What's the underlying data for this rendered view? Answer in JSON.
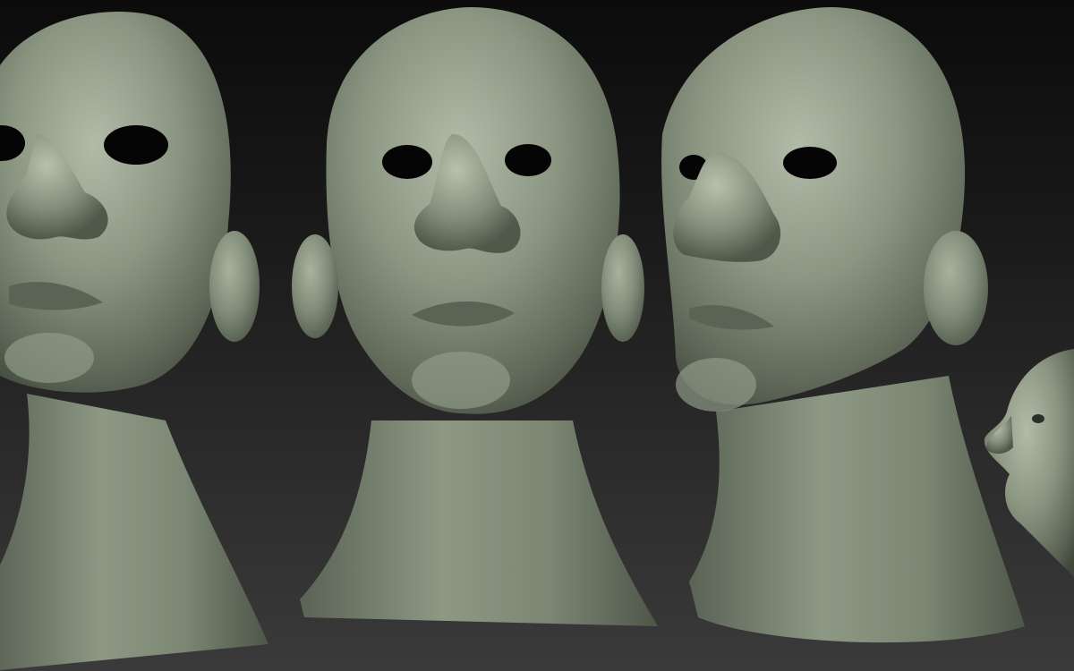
{
  "scene": {
    "description_tokens": [],
    "colors": {
      "background_top": "#0b0b0b",
      "background_bottom": "#3a3a3a",
      "clay_base": "#7f8b78",
      "clay_light": "#aab3a1",
      "clay_dark": "#4b5346",
      "cavity": "#050505"
    },
    "models": [
      {
        "name": "head-front-cropped-left"
      },
      {
        "name": "head-front"
      },
      {
        "name": "head-three-quarter"
      },
      {
        "name": "head-profile-cropped-right"
      }
    ]
  }
}
